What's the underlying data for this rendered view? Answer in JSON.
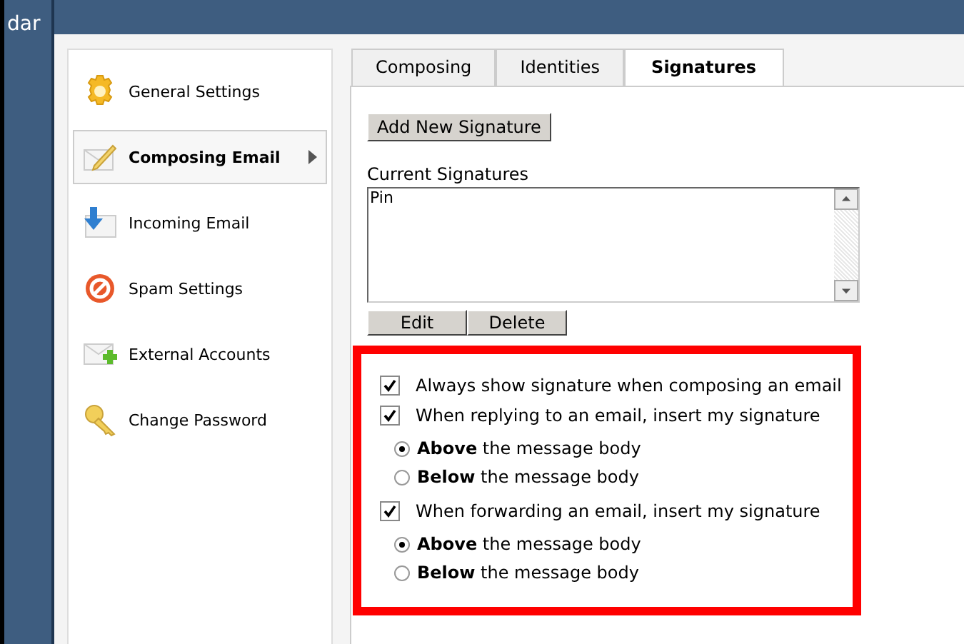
{
  "background_app": {
    "title_fragment": "dar"
  },
  "sidebar": {
    "items": [
      {
        "label": "General Settings",
        "selected": false
      },
      {
        "label": "Composing Email",
        "selected": true
      },
      {
        "label": "Incoming Email",
        "selected": false
      },
      {
        "label": "Spam Settings",
        "selected": false
      },
      {
        "label": "External Accounts",
        "selected": false
      },
      {
        "label": "Change Password",
        "selected": false
      }
    ]
  },
  "tabs": [
    {
      "label": "Composing",
      "selected": false
    },
    {
      "label": "Identities",
      "selected": false
    },
    {
      "label": "Signatures",
      "selected": true
    }
  ],
  "add_button": "Add New Signature",
  "signatures": {
    "label": "Current Signatures",
    "items": [
      "Pin"
    ]
  },
  "list_buttons": [
    "Edit",
    "Delete"
  ],
  "options": [
    {
      "kind": "checkbox",
      "label": "Always show signature when composing an email",
      "checked": true
    },
    {
      "kind": "checkbox",
      "label": "When replying to an email, insert my signature",
      "checked": true
    },
    {
      "kind": "radio",
      "label": "**Above** the message body",
      "selected": true
    },
    {
      "kind": "radio",
      "label": "**Below** the message body",
      "selected": false
    },
    {
      "kind": "checkbox",
      "label": "When forwarding an email, insert my signature",
      "checked": true
    },
    {
      "kind": "radio",
      "label": "**Above** the message body",
      "selected": true
    },
    {
      "kind": "radio",
      "label": "**Below** the message body",
      "selected": false
    }
  ]
}
